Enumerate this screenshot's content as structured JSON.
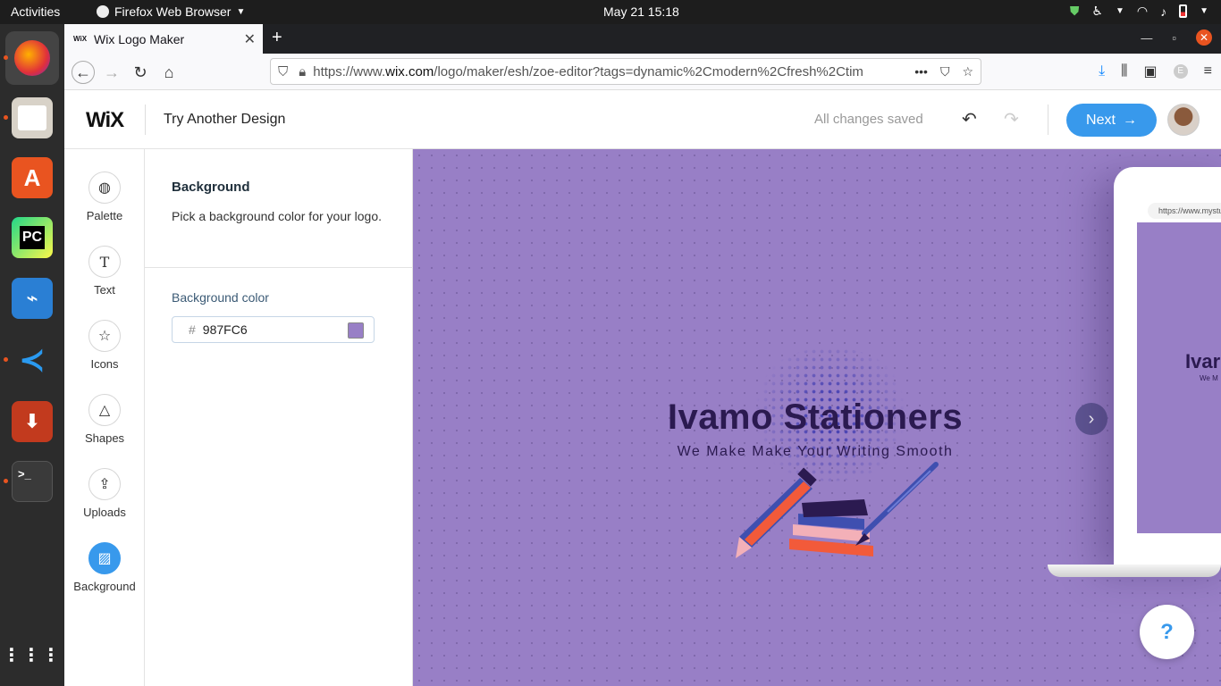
{
  "system": {
    "activities": "Activities",
    "app_name": "Firefox Web Browser",
    "clock": "May 21  15:18"
  },
  "dock": {
    "items": [
      "firefox-icon",
      "files-icon",
      "software-center-icon",
      "pycharm-icon",
      "system-monitor-icon",
      "vscode-icon",
      "downloader-icon",
      "terminal-icon",
      "app-grid-icon"
    ]
  },
  "browser": {
    "tab_title": "Wix Logo Maker",
    "tab_favicon": "WiX",
    "url_prefix": "https://www.",
    "url_domain": "wix.com",
    "url_path": "/logo/maker/esh/zoe-editor?tags=dynamic%2Cmodern%2Cfresh%2Ctim"
  },
  "wix_header": {
    "logo": "WiX",
    "try_another": "Try Another Design",
    "status": "All changes saved",
    "next_label": "Next"
  },
  "tools": [
    {
      "label": "Palette",
      "icon": "palette-icon"
    },
    {
      "label": "Text",
      "icon": "text-icon"
    },
    {
      "label": "Icons",
      "icon": "star-icon"
    },
    {
      "label": "Shapes",
      "icon": "shapes-icon"
    },
    {
      "label": "Uploads",
      "icon": "upload-icon"
    },
    {
      "label": "Background",
      "icon": "background-icon"
    }
  ],
  "panel": {
    "title": "Background",
    "description": "Pick a background color for your logo.",
    "color_label": "Background color",
    "color_hash": "#",
    "color_value": "987FC6"
  },
  "canvas": {
    "bg_color": "#987FC6",
    "brand_name": "Ivamo Stationers",
    "tagline": "We Make Make Your Writing Smooth",
    "preview_url": "https://www.mystu",
    "preview_brand": "Ivar",
    "preview_tag": "We M"
  },
  "help_label": "?"
}
